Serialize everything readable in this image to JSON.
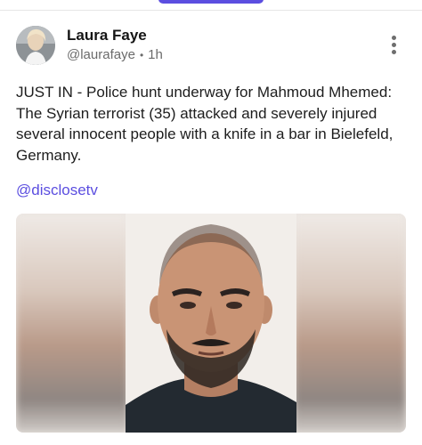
{
  "post": {
    "author": {
      "name": "Laura Faye",
      "handle": "@laurafaye",
      "time": "1h"
    },
    "text": "JUST IN - Police hunt underway for Mahmoud Mhemed: The Syrian terrorist (35) attacked and severely injured several innocent people with a knife in a bar in Bielefeld, Germany.",
    "mention": "@disclosetv",
    "icons": {
      "more": "more-vertical-icon"
    }
  },
  "colors": {
    "accent": "#5b4ee0",
    "muted": "#6b6b6b"
  }
}
